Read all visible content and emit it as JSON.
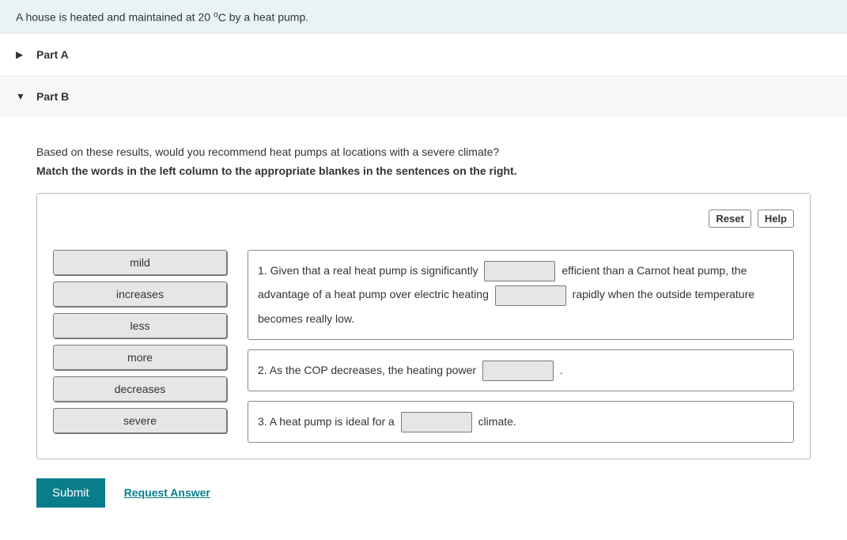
{
  "banner": {
    "prefix": "A house is heated and maintained at ",
    "value": "20",
    "unit_pre_sup": "",
    "deg": "o",
    "unit_post": "C",
    "suffix": " by a heat pump."
  },
  "parts": {
    "a": {
      "title": "Part A"
    },
    "b": {
      "title": "Part B",
      "question": "Based on these results, would you recommend heat pumps at locations with a severe climate?",
      "instruction": "Match the words in the left column to the appropriate blankes in the sentences on the right.",
      "toolbar": {
        "reset": "Reset",
        "help": "Help"
      },
      "word_bank": [
        "mild",
        "increases",
        "less",
        "more",
        "decreases",
        "severe"
      ],
      "sentences": {
        "s1": {
          "t1": "1. Given that a real heat pump is significantly",
          "t2": "efficient than a Carnot heat pump, the advantage of a heat pump over electric heating",
          "t3": "rapidly when the outside temperature becomes really low."
        },
        "s2": {
          "t1": "2. As the COP decreases, the heating power",
          "t2": "."
        },
        "s3": {
          "t1": "3. A heat pump is ideal for a",
          "t2": "climate."
        }
      },
      "submit": "Submit",
      "request_answer": "Request Answer"
    }
  }
}
